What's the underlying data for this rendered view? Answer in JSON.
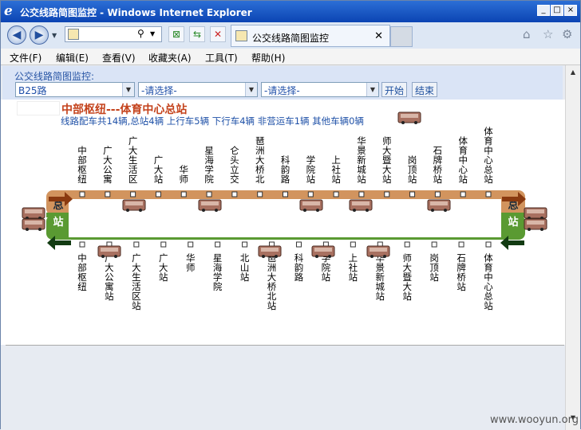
{
  "window": {
    "title": "公交线路简图监控 - Windows Internet Explorer"
  },
  "browser": {
    "address_text": "",
    "tab_title": "公交线路简图监控",
    "menu": [
      "文件(F)",
      "编辑(E)",
      "查看(V)",
      "收藏夹(A)",
      "工具(T)",
      "帮助(H)"
    ]
  },
  "controls": {
    "label": "公交线路简图监控:",
    "route_select": "B25路",
    "select2": "-请选择-",
    "select3": "-请选择-",
    "start_button": "开始",
    "end_button": "结束"
  },
  "route": {
    "name": "中部枢纽---体育中心总站",
    "stats": "线路配车共14辆,总站4辆 上行车5辆 下行车4辆 非营运车1辆 其他车辆0辆",
    "up_stops": [
      "中部枢纽",
      "广大公寓",
      "广大生活区",
      "广大站",
      "华师",
      "星海学院",
      "仑头立交",
      "琶洲大桥北",
      "科韵路",
      "学院站",
      "上社站",
      "华景新城站",
      "师大暨大站",
      "岗顶站",
      "石牌桥站",
      "体育中心站",
      "体育中心总站"
    ],
    "down_stops": [
      "中部枢纽",
      "广大公寓站",
      "广大生活区站",
      "广大站",
      "华师",
      "星海学院",
      "北山站",
      "琶洲大桥北站",
      "科韵路",
      "学院站",
      "上社站",
      "华景新城站",
      "师大暨大站",
      "岗顶站",
      "石牌桥站",
      "体育中心总站"
    ],
    "left_terminal": "总站",
    "right_terminal": "总站",
    "colors": {
      "up_line": "#d2945e",
      "down_line": "#5a9a32",
      "title": "#c4421b",
      "stats": "#2052a8"
    }
  },
  "watermark": "www.wooyun.org"
}
